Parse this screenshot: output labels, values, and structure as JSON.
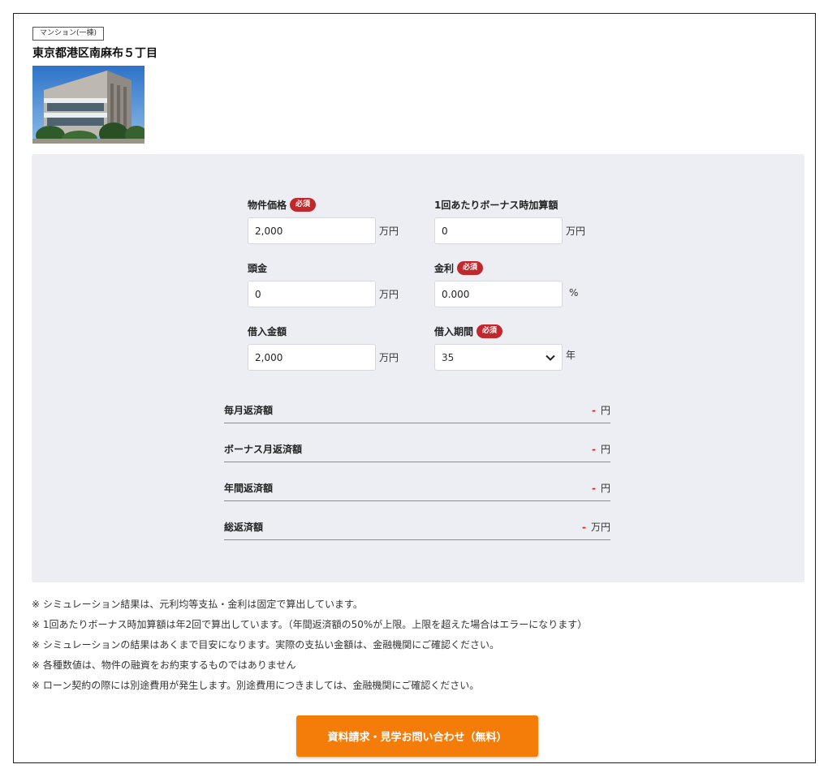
{
  "listing": {
    "type_tag": "マンション(一棟)",
    "address": "東京都港区南麻布５丁目"
  },
  "form": {
    "required_badge": "必須",
    "price": {
      "label": "物件価格",
      "value": "2,000",
      "unit": "万円"
    },
    "bonus": {
      "label": "1回あたりボーナス時加算額",
      "value": "0",
      "unit": "万円"
    },
    "down_payment": {
      "label": "頭金",
      "value": "0",
      "unit": "万円"
    },
    "interest": {
      "label": "金利",
      "value": "0.000",
      "unit": "%"
    },
    "loan_amount": {
      "label": "借入金額",
      "value": "2,000",
      "unit": "万円"
    },
    "term": {
      "label": "借入期間",
      "value": "35",
      "unit": "年"
    }
  },
  "results": [
    {
      "label": "毎月返済額",
      "value": "-",
      "unit": "円"
    },
    {
      "label": "ボーナス月返済額",
      "value": "-",
      "unit": "円"
    },
    {
      "label": "年間返済額",
      "value": "-",
      "unit": "円"
    },
    {
      "label": "総返済額",
      "value": "-",
      "unit": "万円"
    }
  ],
  "notes": [
    "※ シミュレーション結果は、元利均等支払・金利は固定で算出しています。",
    "※ 1回あたりボーナス時加算額は年2回で算出しています。（年間返済額の50%が上限。上限を超えた場合はエラーになります）",
    "※ シミュレーションの結果はあくまで目安になります。実際の支払い金額は、金融機関にご確認ください。",
    "※ 各種数値は、物件の融資をお約束するものではありません",
    "※ ローン契約の際には別途費用が発生します。別途費用につきましては、金融機関にご確認ください。"
  ],
  "cta": {
    "label": "資料請求・見学お問い合わせ（無料）"
  },
  "colors": {
    "panel_bg": "#eceef3",
    "required_badge": "#c0282d",
    "result_dash": "#e0201b",
    "cta_bg": "#f47c09"
  }
}
